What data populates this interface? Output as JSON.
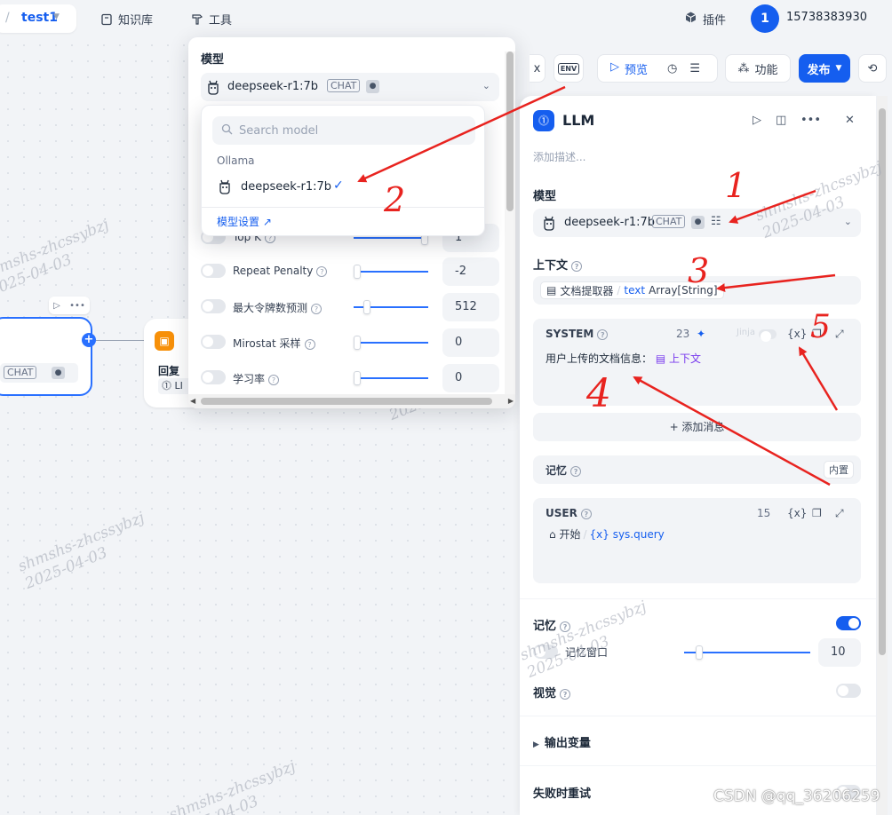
{
  "topbar": {
    "app_slash": "/",
    "app_name": "test1",
    "knowledge_label": "知识库",
    "tools_label": "工具",
    "plugin_label": "插件",
    "avatar_initial": "1",
    "phone": "15738383930"
  },
  "canvas": {
    "llm_node_chat": "CHAT",
    "reply_node_title": "回复",
    "reply_node_sub": "LI",
    "watermark": "shmshs-zhcssybzj\n2025-04-03"
  },
  "model_panel": {
    "heading": "模型",
    "model_name": "deepseek-r1:7b",
    "model_tag": "CHAT",
    "params": [
      {
        "label": "Top K",
        "value": "1",
        "level": 1.0
      },
      {
        "label": "Repeat Penalty",
        "value": "-2",
        "level": 0.0
      },
      {
        "label": "最大令牌数预测",
        "value": "512",
        "level": 0.15
      },
      {
        "label": "Mirostat 采样",
        "value": "0",
        "level": 0.0
      },
      {
        "label": "学习率",
        "value": "0",
        "level": 0.0
      }
    ]
  },
  "search_popover": {
    "placeholder": "Search model",
    "provider": "Ollama",
    "option_name": "deepseek-r1:7b",
    "settings_link": "模型设置 ↗"
  },
  "toolbar": {
    "env_label": "ENV",
    "preview_label": "预览",
    "features_label": "功能",
    "publish_label": "发布"
  },
  "llm_panel": {
    "title": "LLM",
    "description_placeholder": "添加描述...",
    "model_section": "模型",
    "model_name": "deepseek-r1:7b",
    "model_tag": "CHAT",
    "context_section": "上下文",
    "context_node": "文档提取器",
    "context_var": "text",
    "context_type": "Array[String]",
    "system": {
      "title": "SYSTEM",
      "count": "23",
      "jinja": "Jinja",
      "var_btn": "{x}",
      "body_text": "用户上传的文档信息：",
      "body_var": "上下文"
    },
    "add_message": "+ 添加消息",
    "memory_row_label": "记忆",
    "memory_badge": "内置",
    "user": {
      "title": "USER",
      "count": "15",
      "var_btn": "{x}",
      "start_node": "开始",
      "start_var": "{x} sys.query"
    },
    "memory_section": "记忆",
    "memory_window_label": "记忆窗口",
    "memory_window_value": "10",
    "memory_window_level": 0.1,
    "vision_label": "视觉",
    "output_vars_label": "输出变量",
    "retry_label": "失败时重试"
  },
  "annotations": {
    "numbers": [
      "1",
      "2",
      "3",
      "4",
      "5"
    ],
    "color": "#e8231f"
  },
  "csdn_watermark": "CSDN @qq_36206259"
}
